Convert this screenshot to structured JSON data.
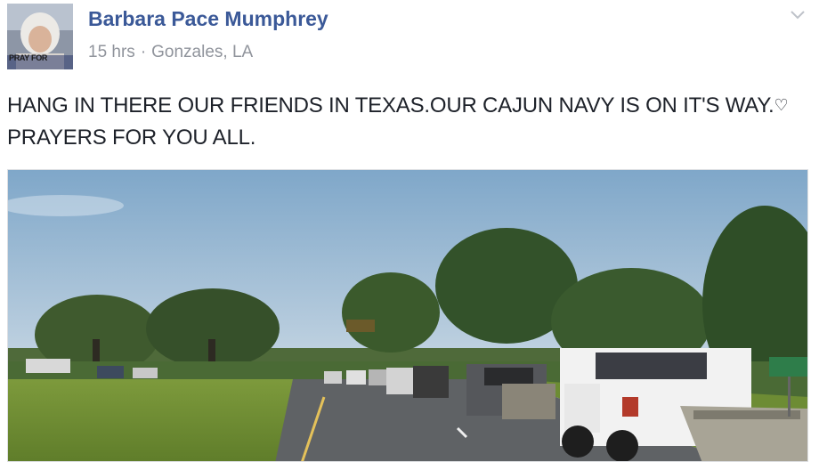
{
  "post": {
    "author_name": "Barbara Pace Mumphrey",
    "time": "15 hrs",
    "separator": "·",
    "location": "Gonzales, LA",
    "text": "HANG IN THERE OUR FRIENDS IN TEXAS.OUR CAJUN NAVY IS ON IT'S WAY.",
    "text_heart": "♡",
    "text_end": " PRAYERS FOR YOU ALL.",
    "avatar_caption": "PRAY FOR",
    "menu_icon": "chevron-down-icon"
  },
  "colors": {
    "author_link": "#3b5998",
    "meta_gray": "#90949c",
    "body_text": "#1d2129"
  },
  "photo": {
    "description_icon": "photo",
    "sign_text": ""
  }
}
